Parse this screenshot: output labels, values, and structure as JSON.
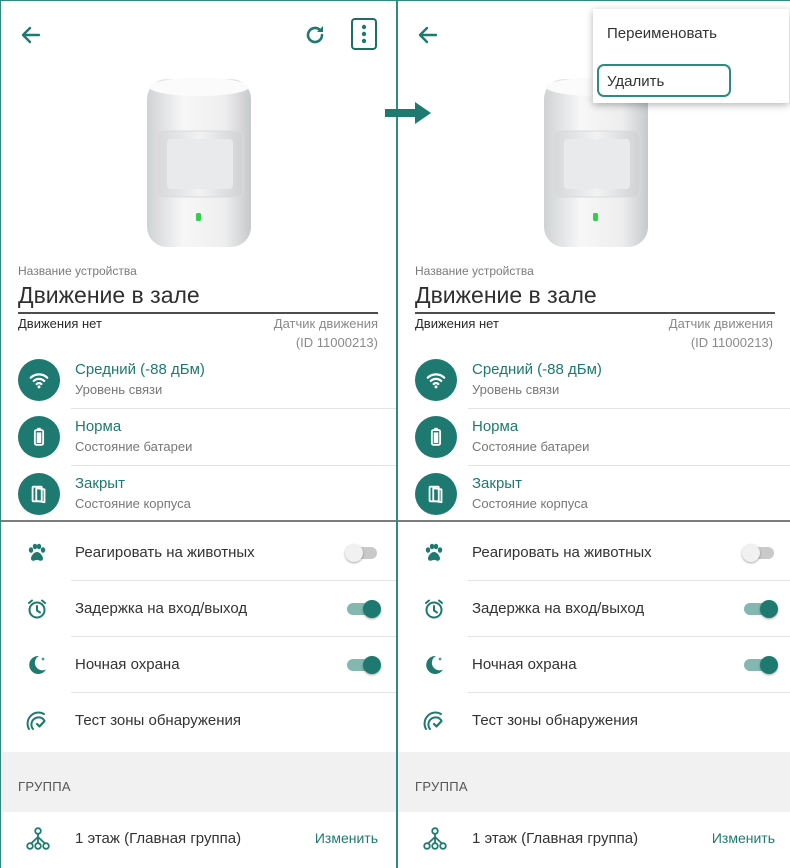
{
  "device": {
    "name_label": "Название устройства",
    "name": "Движение в зале",
    "motion_status": "Движения нет",
    "type": "Датчик движения",
    "id": "(ID 11000213)"
  },
  "status": [
    {
      "primary": "Средний (-88 дБм)",
      "secondary": "Уровень связи",
      "icon": "wifi-signal-icon"
    },
    {
      "primary": "Норма",
      "secondary": "Состояние батареи",
      "icon": "battery-icon"
    },
    {
      "primary": "Закрыт",
      "secondary": "Состояние корпуса",
      "icon": "tamper-case-icon"
    }
  ],
  "settings": [
    {
      "label": "Реагировать на животных",
      "icon": "paw-icon",
      "toggle": "off"
    },
    {
      "label": "Задержка на вход/выход",
      "icon": "timer-icon",
      "toggle": "on"
    },
    {
      "label": "Ночная охрана",
      "icon": "night-moon-icon",
      "toggle": "on"
    },
    {
      "label": "Тест зоны обнаружения",
      "icon": "detection-test-icon",
      "toggle": "none"
    }
  ],
  "group": {
    "header": "ГРУППА",
    "name": "1 этаж (Главная группа)",
    "edit_label": "Изменить"
  },
  "menu": {
    "rename": "Переименовать",
    "delete": "Удалить"
  },
  "colors": {
    "accent": "#1e7a70",
    "border": "#2f8a7f",
    "group_bg": "#f1f1f1"
  }
}
